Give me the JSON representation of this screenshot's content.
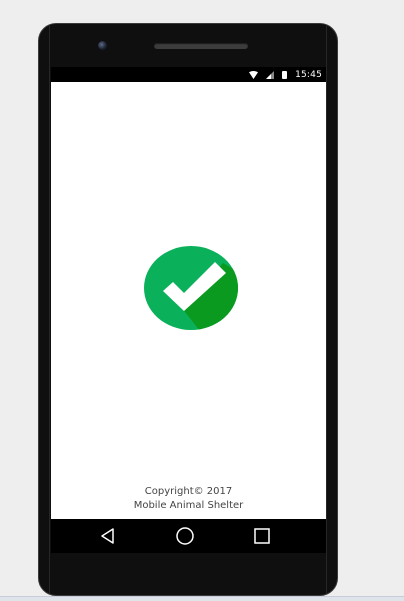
{
  "device": {
    "frame_color": "#0f0f0f",
    "screen_background": "#ffffff"
  },
  "status_bar": {
    "time": "15:45",
    "icons": [
      "wifi-icon",
      "signal-icon",
      "battery-icon"
    ]
  },
  "splash": {
    "logo_icon": "check-circle-icon",
    "logo_colors": {
      "primary": "#0bb05a",
      "shade": "#0a9a1f",
      "check": "#ffffff"
    },
    "copyright_line1": "Copyright© 2017",
    "copyright_line2": "Mobile Animal Shelter"
  },
  "nav_bar": {
    "buttons": [
      "back-icon",
      "home-icon",
      "recents-icon"
    ]
  }
}
